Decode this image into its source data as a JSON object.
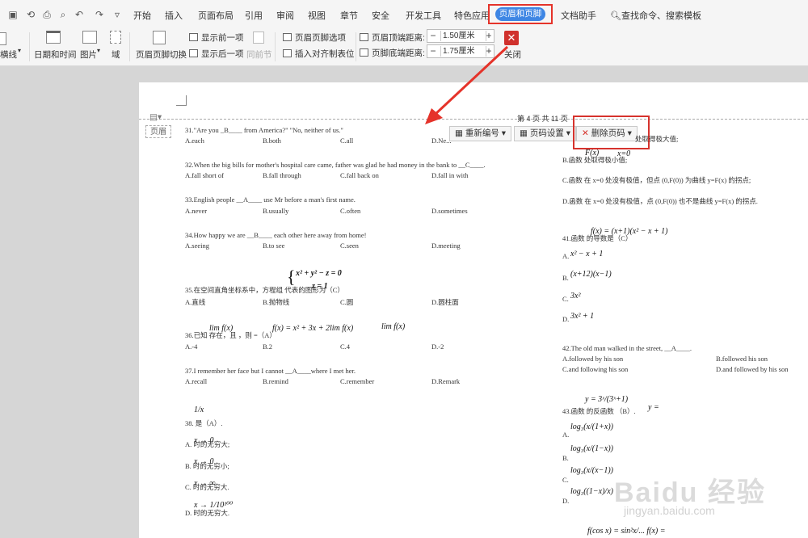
{
  "menu": {
    "tabs": [
      "开始",
      "插入",
      "页面布局",
      "引用",
      "审阅",
      "视图",
      "章节",
      "安全",
      "开发工具",
      "特色应用"
    ],
    "active_tab": "页眉和页脚",
    "assistant": "文档助手",
    "search": "查找命令、搜索模板"
  },
  "ribbon": {
    "border_line": "横线",
    "date_time": "日期和时间",
    "picture": "图片",
    "field": "域",
    "switch": "页眉页脚切换",
    "show_prev": "显示前一项",
    "show_next": "显示后一项",
    "same_as_prev": "同前节",
    "options": "页眉页脚选项",
    "insert_tab": "插入对齐制表位",
    "header_top_label": "页眉顶端距离:",
    "header_top_value": "1.50厘米",
    "footer_bottom_label": "页脚底端距离:",
    "footer_bottom_value": "1.75厘米",
    "close": "关闭"
  },
  "header_tools": {
    "label": "页眉",
    "page_info": "第 4 页 共 11 页",
    "renumber": "重新编号",
    "page_setting": "页码设置",
    "delete_page_number": "删除页码"
  },
  "left_col": [
    {
      "q": "31.\"Are you _B____ from America?\" \"No, neither of us.\"",
      "opts": [
        "A.each",
        "B.both",
        "C.all",
        "D.Ne..."
      ]
    },
    {
      "q": "32.When the big bills for mother's hospital care came, father was glad he had money in the bank to __C____.",
      "opts": [
        "A.fall short of",
        "B.fall through",
        "C.fall back on",
        "D.fall in with"
      ]
    },
    {
      "q": "33.English people __A____ use Mr before a man's first name.",
      "opts": [
        "A.never",
        "B.usually",
        "C.often",
        "D.sometimes"
      ]
    },
    {
      "q": "34.How happy we are __B____ each other here away from home!",
      "opts": [
        "A.seeing",
        "B.to see",
        "C.seen",
        "D.meeting"
      ]
    },
    {
      "q": "35.在空间直角坐标系中，方程组                代表的图形为（C）",
      "opts": [
        "A.直线",
        "B.抛物线",
        "C.圆",
        "D.圆柱面"
      ]
    },
    {
      "q": "36.已知           存在，且                                  ，则           =（A）",
      "opts": [
        "A.-4",
        "B.2",
        "C.4",
        "D.-2"
      ]
    },
    {
      "q": "37.I remember her face but I cannot __A____where I met her.",
      "opts": [
        "A.recall",
        "B.remind",
        "C.remember",
        "D.Remark"
      ]
    }
  ],
  "q38": {
    "stem": "38.    是（A）.",
    "a": "A.        时的无穷大;",
    "b": "B.        时的无穷小;",
    "c": "C.        时的无穷大.",
    "d": "D.                   时的无穷大."
  },
  "right_col": {
    "r1": "处取得极大值;",
    "b": "B.函数         处取得极小值;",
    "c": "C.函数      在 x=0 处没有极值，但点 (0,F(0)) 为曲线 y=F(x) 的拐点;",
    "d": "D.函数      在 x=0 处没有极值，点 (0,F(0)) 也不是曲线 y=F(x) 的拐点.",
    "q41": "41.函数                                    的导数是（C）",
    "q41_opts": [
      "A.",
      "B.",
      "C.",
      "D."
    ],
    "q42": "42.The old man walked in the street, __A____.",
    "q42_opts": [
      "A.followed by his son",
      "B.followed his son",
      "C.and following his son",
      "D.and followed by his son"
    ],
    "q43": "43.函数               的反函数     （B）.",
    "q43_opts": [
      "A.",
      "B.",
      "C.",
      "D."
    ]
  },
  "math": {
    "sys1": "x² + y² − z = 0",
    "sys2": "z = 1",
    "lim1": "lim f(x)",
    "eq36": "f(x) = x² + 3x + 2lim f(x)",
    "lim2": "lim f(x)",
    "frac38": "1/x",
    "x0a": "x → 0",
    "x0b": "x → 0",
    "xinf": "x → ∞",
    "x38d": "x → 1/10¹⁰⁰",
    "Fx": "F(x)",
    "x0": "x=0",
    "f41": "f(x) = (x+1)(x² − x + 1)",
    "a41": "x² − x + 1",
    "b41": "(x+12)(x−1)",
    "c41": "3x²",
    "d41": "3x² + 1",
    "y43": "y = 3ˣ/(3ˣ+1)",
    "yy": "y =",
    "a43": "log₃(x/(1+x))",
    "b43": "log₃(x/(1−x))",
    "c43": "log₃(x/(x−1))",
    "d43": "log₃((1−x)/x)",
    "bottom": "f(cos x) = sin²x/...     f(x) ="
  },
  "watermark": {
    "main": "Baidu 经验",
    "sub": "jingyan.baidu.com"
  },
  "colors": {
    "accent": "#3e86e4",
    "highlight": "#e5332a",
    "close": "#d0312d"
  }
}
